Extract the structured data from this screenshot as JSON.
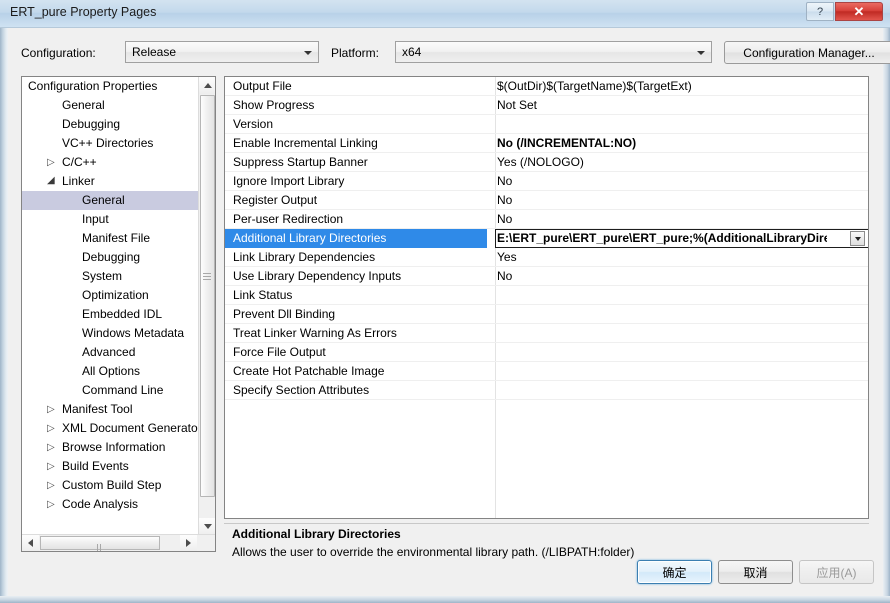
{
  "window": {
    "title": "ERT_pure Property Pages",
    "help_button": "?",
    "close_button": "✕",
    "accent_blue": "#2f8ae8",
    "titlebar_color": "#c3d9ec",
    "close_color": "#d8413a"
  },
  "toolbar": {
    "configuration_label": "Configuration:",
    "configuration_value": "Release",
    "platform_label": "Platform:",
    "platform_value": "x64",
    "configuration_manager_label": "Configuration Manager..."
  },
  "tree": {
    "items": [
      {
        "label": "Configuration Properties",
        "indent": 6,
        "expander": "open",
        "selected": false
      },
      {
        "label": "General",
        "indent": 40,
        "expander": "none",
        "selected": false
      },
      {
        "label": "Debugging",
        "indent": 40,
        "expander": "none",
        "selected": false
      },
      {
        "label": "VC++ Directories",
        "indent": 40,
        "expander": "none",
        "selected": false
      },
      {
        "label": "C/C++",
        "indent": 40,
        "expander": "closed",
        "selected": false
      },
      {
        "label": "Linker",
        "indent": 40,
        "expander": "open",
        "selected": false
      },
      {
        "label": "General",
        "indent": 60,
        "expander": "none",
        "selected": true
      },
      {
        "label": "Input",
        "indent": 60,
        "expander": "none",
        "selected": false
      },
      {
        "label": "Manifest File",
        "indent": 60,
        "expander": "none",
        "selected": false
      },
      {
        "label": "Debugging",
        "indent": 60,
        "expander": "none",
        "selected": false
      },
      {
        "label": "System",
        "indent": 60,
        "expander": "none",
        "selected": false
      },
      {
        "label": "Optimization",
        "indent": 60,
        "expander": "none",
        "selected": false
      },
      {
        "label": "Embedded IDL",
        "indent": 60,
        "expander": "none",
        "selected": false
      },
      {
        "label": "Windows Metadata",
        "indent": 60,
        "expander": "none",
        "selected": false
      },
      {
        "label": "Advanced",
        "indent": 60,
        "expander": "none",
        "selected": false
      },
      {
        "label": "All Options",
        "indent": 60,
        "expander": "none",
        "selected": false
      },
      {
        "label": "Command Line",
        "indent": 60,
        "expander": "none",
        "selected": false
      },
      {
        "label": "Manifest Tool",
        "indent": 40,
        "expander": "closed",
        "selected": false
      },
      {
        "label": "XML Document Generator",
        "indent": 40,
        "expander": "closed",
        "selected": false
      },
      {
        "label": "Browse Information",
        "indent": 40,
        "expander": "closed",
        "selected": false
      },
      {
        "label": "Build Events",
        "indent": 40,
        "expander": "closed",
        "selected": false
      },
      {
        "label": "Custom Build Step",
        "indent": 40,
        "expander": "closed",
        "selected": false
      },
      {
        "label": "Code Analysis",
        "indent": 40,
        "expander": "closed",
        "selected": false
      }
    ]
  },
  "grid": {
    "rows": [
      {
        "name": "Output File",
        "value": "$(OutDir)$(TargetName)$(TargetExt)",
        "bold": false,
        "selected": false
      },
      {
        "name": "Show Progress",
        "value": "Not Set",
        "bold": false,
        "selected": false
      },
      {
        "name": "Version",
        "value": "",
        "bold": false,
        "selected": false
      },
      {
        "name": "Enable Incremental Linking",
        "value": "No (/INCREMENTAL:NO)",
        "bold": true,
        "selected": false
      },
      {
        "name": "Suppress Startup Banner",
        "value": "Yes (/NOLOGO)",
        "bold": false,
        "selected": false
      },
      {
        "name": "Ignore Import Library",
        "value": "No",
        "bold": false,
        "selected": false
      },
      {
        "name": "Register Output",
        "value": "No",
        "bold": false,
        "selected": false
      },
      {
        "name": "Per-user Redirection",
        "value": "No",
        "bold": false,
        "selected": false
      },
      {
        "name": "Additional Library Directories",
        "value": "E:\\ERT_pure\\ERT_pure\\ERT_pure;%(AdditionalLibraryDirect",
        "bold": true,
        "selected": true
      },
      {
        "name": "Link Library Dependencies",
        "value": "Yes",
        "bold": false,
        "selected": false
      },
      {
        "name": "Use Library Dependency Inputs",
        "value": "No",
        "bold": false,
        "selected": false
      },
      {
        "name": "Link Status",
        "value": "",
        "bold": false,
        "selected": false
      },
      {
        "name": "Prevent Dll Binding",
        "value": "",
        "bold": false,
        "selected": false
      },
      {
        "name": "Treat Linker Warning As Errors",
        "value": "",
        "bold": false,
        "selected": false
      },
      {
        "name": "Force File Output",
        "value": "",
        "bold": false,
        "selected": false
      },
      {
        "name": "Create Hot Patchable Image",
        "value": "",
        "bold": false,
        "selected": false
      },
      {
        "name": "Specify Section Attributes",
        "value": "",
        "bold": false,
        "selected": false
      }
    ]
  },
  "description": {
    "title": "Additional Library Directories",
    "text": "Allows the user to override the environmental library path. (/LIBPATH:folder)"
  },
  "footer": {
    "ok_label": "确定",
    "cancel_label": "取消",
    "apply_label": "应用(A)"
  }
}
